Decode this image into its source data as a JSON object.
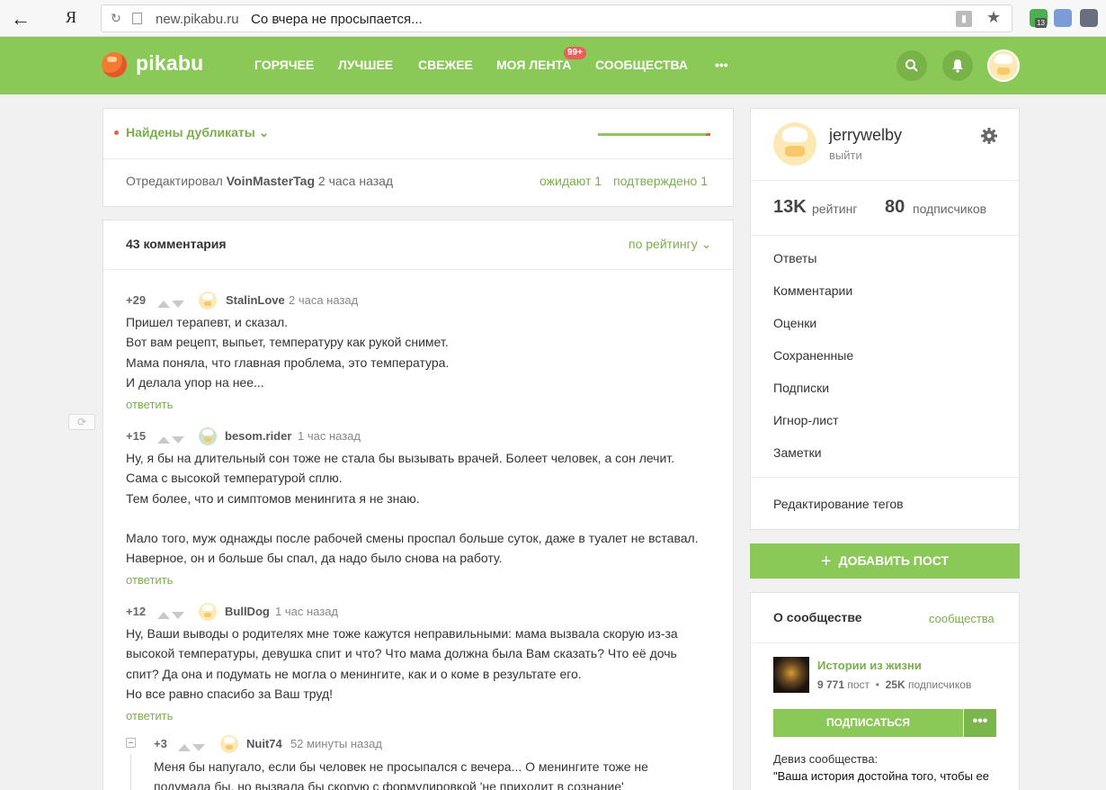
{
  "browser": {
    "back_icon": "←",
    "yandex_logo": "Я",
    "host": "new.pikabu.ru",
    "tab_title": "Со вчера не просыпается...",
    "ext_badge": "13"
  },
  "header": {
    "logo": "pikabu",
    "nav": [
      "ГОРЯЧЕЕ",
      "ЛУЧШЕЕ",
      "СВЕЖЕЕ",
      "МОЯ ЛЕНТА",
      "СООБЩЕСТВА",
      "•••"
    ],
    "feed_badge": "99+"
  },
  "duplicates": {
    "label": "Найдены дубликаты"
  },
  "edit": {
    "prefix": "Отредактировал",
    "editor": "VoinMasterTag",
    "time": "2 часа назад",
    "awaiting": "ожидают 1",
    "confirmed": "подтверждено 1"
  },
  "comments_header": {
    "count": "43 комментария",
    "sort": "по рейтингу"
  },
  "comments": [
    {
      "rating": "+29",
      "author": "StalinLove",
      "time": "2 часа назад",
      "lines": [
        "Пришел терапевт, и сказал.",
        "Вот вам рецепт, выпьет, температуру как рукой снимет.",
        "Мама поняла, что главная проблема, это температура.",
        "И делала упор на нее..."
      ],
      "reply": "ответить"
    },
    {
      "rating": "+15",
      "author": "besom.rider",
      "time": "1 час назад",
      "lines": [
        "Ну, я бы на длительный сон тоже не стала бы вызывать врачей. Болеет человек, а сон лечит.",
        "Сама с высокой температурой сплю.",
        "Тем более, что и симптомов менингита я не знаю.",
        "",
        "Мало того, муж однажды после рабочей смены проспал больше суток, даже в туалет не вставал.",
        "Наверное, он и больше бы спал, да надо было снова на работу."
      ],
      "reply": "ответить"
    },
    {
      "rating": "+12",
      "author": "BullDog",
      "time": "1 час назад",
      "lines": [
        "Ну, Ваши выводы о родителях мне тоже кажутся неправильными: мама вызвала скорую из-за",
        "высокой температуры, девушка спит и что? Что мама должна была Вам сказать? Что её дочь",
        "спит? Да она и подумать не могла о менингите, как и о коме в результате его.",
        "Но все равно спасибо за Ваш труд!"
      ],
      "reply": "ответить"
    },
    {
      "rating": "+3",
      "author": "Nuit74",
      "time": "52 минуты назад",
      "lines": [
        "Меня бы напугало, если бы человек не просыпался с вечера... О менингите тоже не",
        "подумала бы, но вызвала бы скорую с формулировкой 'не приходит в сознание'"
      ]
    }
  ],
  "profile": {
    "username": "jerrywelby",
    "logout": "выйти",
    "rating_value": "13K",
    "rating_label": "рейтинг",
    "subs_value": "80",
    "subs_label": "подписчиков",
    "menu": [
      "Ответы",
      "Комментарии",
      "Оценки",
      "Сохраненные",
      "Подписки",
      "Игнор-лист",
      "Заметки"
    ],
    "edit_tags": "Редактирование тегов"
  },
  "add_post": {
    "icon": "+",
    "label": "ДОБАВИТЬ ПОСТ"
  },
  "community": {
    "title": "О сообществе",
    "link": "сообщества",
    "name": "Истории из жизни",
    "posts": "9 771",
    "posts_label": "пост",
    "subs": "25K",
    "subs_label": "подписчиков",
    "subscribe": "ПОДПИСАТЬСЯ",
    "more": "•••",
    "motto_label": "Девиз сообщества:",
    "motto": "\"Ваша история достойна того, чтобы ее"
  },
  "colors": {
    "brand_green": "#8ac858",
    "link_green": "#7bae4b",
    "badge_red": "#ef5c5c"
  }
}
